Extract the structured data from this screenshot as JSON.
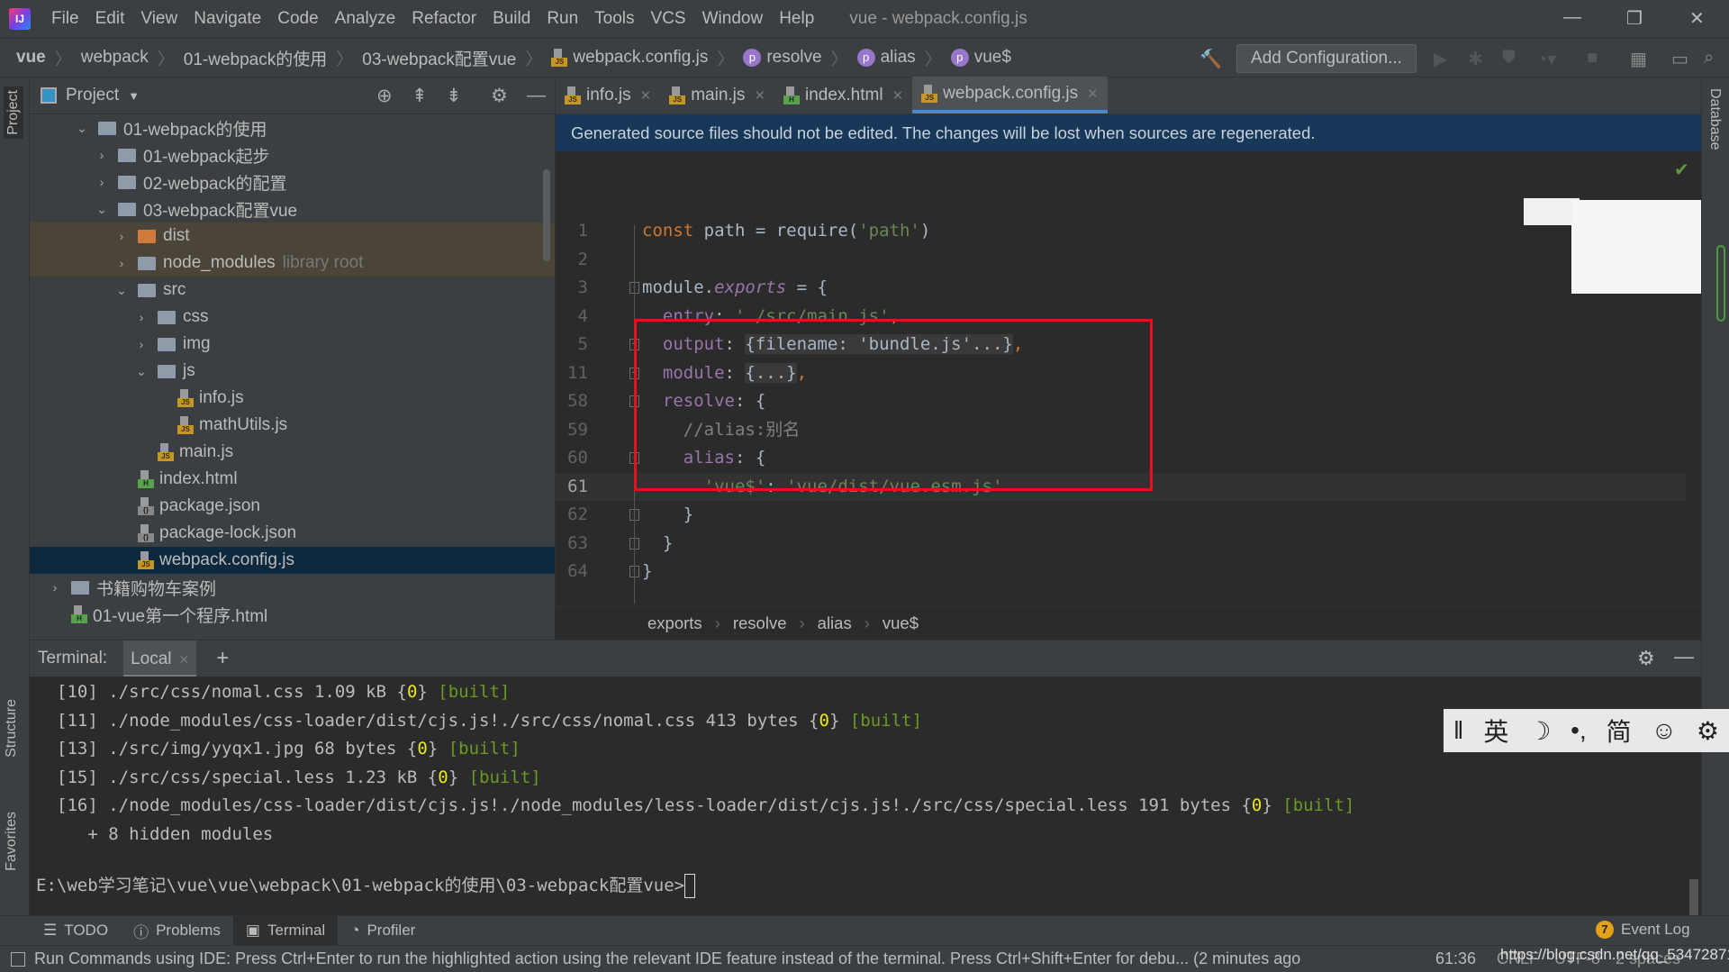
{
  "title": {
    "app_logo": "IJ",
    "menus": [
      "File",
      "Edit",
      "View",
      "Navigate",
      "Code",
      "Analyze",
      "Refactor",
      "Build",
      "Run",
      "Tools",
      "VCS",
      "Window",
      "Help"
    ],
    "window_title": "vue - webpack.config.js"
  },
  "navbar": {
    "crumbs": [
      {
        "label": "vue",
        "icon": ""
      },
      {
        "label": "webpack",
        "icon": ""
      },
      {
        "label": "01-webpack的使用",
        "icon": ""
      },
      {
        "label": "03-webpack配置vue",
        "icon": ""
      },
      {
        "label": "webpack.config.js",
        "icon": "js"
      },
      {
        "label": "resolve",
        "icon": "p"
      },
      {
        "label": "alias",
        "icon": "p"
      },
      {
        "label": "vue$",
        "icon": "p"
      }
    ],
    "add_configuration": "Add Configuration..."
  },
  "left_strip": {
    "project": "Project",
    "structure": "Structure",
    "favorites": "Favorites"
  },
  "right_strip": {
    "database": "Database"
  },
  "project": {
    "title": "Project",
    "tree": [
      {
        "label": "01-webpack的使用",
        "depth": 0,
        "type": "module",
        "open": true
      },
      {
        "label": "01-webpack起步",
        "depth": 1,
        "type": "folder",
        "open": false
      },
      {
        "label": "02-webpack的配置",
        "depth": 1,
        "type": "folder",
        "open": false
      },
      {
        "label": "03-webpack配置vue",
        "depth": 1,
        "type": "folder",
        "open": true
      },
      {
        "label": "dist",
        "depth": 2,
        "type": "folder-orange",
        "open": false,
        "highlight": true
      },
      {
        "label": "node_modules",
        "hint": "library root",
        "depth": 2,
        "type": "folder",
        "open": false,
        "highlight": true
      },
      {
        "label": "src",
        "depth": 2,
        "type": "folder",
        "open": true
      },
      {
        "label": "css",
        "depth": 3,
        "type": "folder",
        "open": false
      },
      {
        "label": "img",
        "depth": 3,
        "type": "folder",
        "open": false
      },
      {
        "label": "js",
        "depth": 3,
        "type": "folder",
        "open": true
      },
      {
        "label": "info.js",
        "depth": 4,
        "type": "js"
      },
      {
        "label": "mathUtils.js",
        "depth": 4,
        "type": "js"
      },
      {
        "label": "main.js",
        "depth": 3,
        "type": "js"
      },
      {
        "label": "index.html",
        "depth": 2,
        "type": "html"
      },
      {
        "label": "package.json",
        "depth": 2,
        "type": "json"
      },
      {
        "label": "package-lock.json",
        "depth": 2,
        "type": "json"
      },
      {
        "label": "webpack.config.js",
        "depth": 2,
        "type": "js",
        "selected": true
      },
      {
        "label": "书籍购物车案例",
        "depth": -1,
        "type": "folder",
        "open": false
      },
      {
        "label": "01-vue第一个程序.html",
        "depth": -1,
        "type": "html",
        "leaf": true
      }
    ]
  },
  "editor": {
    "tabs": [
      {
        "label": "info.js",
        "icon": "js"
      },
      {
        "label": "main.js",
        "icon": "js"
      },
      {
        "label": "index.html",
        "icon": "html"
      },
      {
        "label": "webpack.config.js",
        "icon": "js",
        "active": true
      }
    ],
    "banner": "Generated source files should not be edited. The changes will be lost when sources are regenerated.",
    "lines": [
      {
        "n": "1",
        "tokens": [
          [
            "kw",
            "const "
          ],
          [
            "pl",
            "path = require("
          ],
          [
            "str",
            "'path'"
          ],
          [
            "pl",
            ")"
          ]
        ]
      },
      {
        "n": "2",
        "tokens": []
      },
      {
        "n": "3",
        "fold": "-",
        "tokens": [
          [
            "pl",
            "module."
          ],
          [
            "propi",
            "exports"
          ],
          [
            "pl",
            " = {"
          ]
        ]
      },
      {
        "n": "4",
        "tokens": [
          [
            "prop",
            "  entry"
          ],
          [
            "pl",
            ": "
          ],
          [
            "str",
            "'./src/main.js'"
          ],
          [
            "kw",
            ","
          ]
        ]
      },
      {
        "n": "5",
        "fold": "+",
        "tokens": [
          [
            "prop",
            "  output"
          ],
          [
            "pl",
            ": "
          ],
          [
            "fb",
            "{filename: 'bundle.js'...}"
          ],
          [
            "kw",
            ","
          ]
        ]
      },
      {
        "n": "11",
        "fold": "+",
        "tokens": [
          [
            "prop",
            "  module"
          ],
          [
            "pl",
            ": "
          ],
          [
            "fb",
            "{...}"
          ],
          [
            "kw",
            ","
          ]
        ]
      },
      {
        "n": "58",
        "fold": "-",
        "tokens": [
          [
            "prop",
            "  resolve"
          ],
          [
            "pl",
            ": {"
          ]
        ]
      },
      {
        "n": "59",
        "tokens": [
          [
            "cmt",
            "    //alias:别名"
          ]
        ]
      },
      {
        "n": "60",
        "fold": "-",
        "tokens": [
          [
            "prop",
            "    alias"
          ],
          [
            "pl",
            ": {"
          ]
        ]
      },
      {
        "n": "61",
        "current": true,
        "tokens": [
          [
            "str",
            "      'vue$'"
          ],
          [
            "pl",
            ": "
          ],
          [
            "str",
            "'vue/dist/vue.esm.js'"
          ]
        ]
      },
      {
        "n": "62",
        "fold": "-",
        "tokens": [
          [
            "pl",
            "    }"
          ]
        ]
      },
      {
        "n": "63",
        "fold": "-",
        "tokens": [
          [
            "pl",
            "  }"
          ]
        ]
      },
      {
        "n": "64",
        "fold": "-",
        "tokens": [
          [
            "pl",
            "}"
          ]
        ]
      }
    ],
    "breadcrumbs": [
      "exports",
      "resolve",
      "alias",
      "vue$"
    ]
  },
  "terminal": {
    "label": "Terminal:",
    "tab": "Local",
    "lines": [
      [
        [
          "",
          "[10] ./src/css/nomal.css 1.09 kB {"
        ],
        [
          "y",
          "0"
        ],
        [
          "",
          "} "
        ],
        [
          "g",
          "[built]"
        ]
      ],
      [
        [
          "",
          "[11] ./node_modules/css-loader/dist/cjs.js!./src/css/nomal.css 413 bytes {"
        ],
        [
          "y",
          "0"
        ],
        [
          "",
          "} "
        ],
        [
          "g",
          "[built]"
        ]
      ],
      [
        [
          "",
          "[13] ./src/img/yyqx1.jpg 68 bytes {"
        ],
        [
          "y",
          "0"
        ],
        [
          "",
          "} "
        ],
        [
          "g",
          "[built]"
        ]
      ],
      [
        [
          "",
          "[15] ./src/css/special.less 1.23 kB {"
        ],
        [
          "y",
          "0"
        ],
        [
          "",
          "} "
        ],
        [
          "g",
          "[built]"
        ]
      ],
      [
        [
          "",
          "[16] ./node_modules/css-loader/dist/cjs.js!./node_modules/less-loader/dist/cjs.js!./src/css/special.less 191 bytes {"
        ],
        [
          "y",
          "0"
        ],
        [
          "",
          "} "
        ],
        [
          "g",
          "[built]"
        ]
      ],
      [
        [
          "",
          "   + 8 hidden modules"
        ]
      ]
    ],
    "prompt": "E:\\web学习笔记\\vue\\vue\\webpack\\01-webpack的使用\\03-webpack配置vue>"
  },
  "ime": [
    "英",
    "☽",
    "•,",
    "简",
    "☺",
    "⚙"
  ],
  "bottom_tabs": [
    {
      "label": "TODO",
      "icon": "list"
    },
    {
      "label": "Problems",
      "icon": "info"
    },
    {
      "label": "Terminal",
      "icon": "terminal",
      "active": true
    },
    {
      "label": "Profiler",
      "icon": "profiler"
    }
  ],
  "event_log": {
    "count": "7",
    "label": "Event Log"
  },
  "status": {
    "message": "Run Commands using IDE: Press Ctrl+Enter to run the highlighted action using the relevant IDE feature instead of the terminal. Press Ctrl+Shift+Enter for debu... (2 minutes ago",
    "position": "61:36",
    "line_sep": "CRLF",
    "encoding": "UTF-8",
    "indent": "2 spaces",
    "watermark": "https://blog.csdn.net/qq_53472871"
  }
}
